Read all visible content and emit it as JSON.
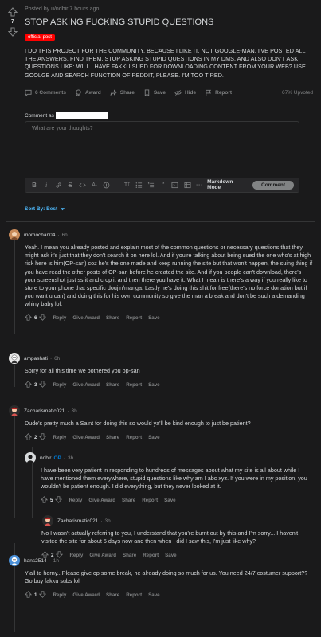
{
  "post": {
    "score": "7",
    "meta": "Posted by u/ndbir 7 hours ago",
    "title": "STOP ASKING FUCKING STUPID QUESTIONS",
    "flair": "official post",
    "body": "I DO THIS PROJECT FOR THE COMMUNITY, BECAUSE I LIKE IT, NOT GOOGLE-MAN. I'VE POSTED ALL THE ANSWERS, FIND THEM, STOP ASKING STUPID QUESTIONS IN MY DMS. AND ALSO DON'T ASK QUESTIONS LIKE: WILL I HAVE FAKKU SUED FOR DOWNLOADING CONTENT FROM YOUR WEB? USE GOOLGE AND SEARCH FUNCTION OF REDDIT, PLEASE. I'M TOO TIRED.",
    "actions": {
      "comments": "6 Comments",
      "award": "Award",
      "share": "Share",
      "save": "Save",
      "hide": "Hide",
      "report": "Report",
      "upvoted": "67% Upvoted"
    }
  },
  "composer": {
    "comment_as": "Comment as",
    "placeholder": "What are your thoughts?",
    "markdown_mode": "Markdown Mode",
    "submit": "Comment"
  },
  "sort": {
    "label": "Sort By: Best"
  },
  "comments": [
    {
      "user": "momochan04",
      "time": "6h",
      "avatar_color": "#c98b5a",
      "body": "Yeah. I mean you already posted and explain most of the common questions or necessary questions that they might ask it's just that they don't search it on here lol. And if you're talking about being sued the one who's at high risk here is him(OP-san) coz he's the one made and keep running the site but that won't happen, the suing thing if you have read the other posts of OP-san before he created the site. And if you people can't download, there's your screenshot just ss it and crop it and then there you have it. What I mean is there's a way if you really like to store to your phone that specific doujin/manga. Lastly he's doing this shit for free(there's no force donation but if you want u can) and doing this for his own community so give the man a break and don't be such a demanding whiny baby lol.",
      "score": "6",
      "actions": [
        "Reply",
        "Give Award",
        "Share",
        "Report",
        "Save"
      ]
    },
    {
      "user": "ampashati",
      "time": "6h",
      "avatar_color": "#e8e8e8",
      "body": "Sorry for all this time we bothered you op-san",
      "score": "3",
      "actions": [
        "Reply",
        "Give Award",
        "Share",
        "Report",
        "Save"
      ]
    },
    {
      "user": "Zacharismatic021",
      "time": "3h",
      "avatar_color": "#d9534f",
      "body": "Dude's pretty much a Saint for doing this so would ya'll be kind enough to just be patient?",
      "score": "2",
      "actions": [
        "Reply",
        "Give Award",
        "Share",
        "Report",
        "Save"
      ]
    },
    {
      "user": "ndbir",
      "op": "OP",
      "time": "3h",
      "avatar_color": "#d7dadc",
      "body": "I have been very patient in responding to hundreds of messages about what my site is all about while I have mentioned them everywhere, stupid questions like why am I abc xyz. If you were in my position, you wouldn't be patient enough. I did everything, but they never looked at it.",
      "score": "5",
      "actions": [
        "Reply",
        "Give Award",
        "Share",
        "Report",
        "Save"
      ]
    },
    {
      "user": "Zacharismatic021",
      "time": "3h",
      "avatar_color": "#d9534f",
      "body": "No I wasn't actually referring to you, I understand that you're burnt out by this and I'm sorry... I haven't visited the site for about 5 days now and then when I did I saw this, I'm just like why?",
      "score": "2",
      "actions": [
        "Reply",
        "Give Award",
        "Share",
        "Report",
        "Save"
      ]
    },
    {
      "user": "hans2514",
      "time": "1h",
      "avatar_color": "#4a90d9",
      "body": "Y'all to horny.. Please give op some break, he already doing so much for us. You need 24/7 costumer support?? Go buy fakku subs lol",
      "score": "1",
      "actions": [
        "Reply",
        "Give Award",
        "Share",
        "Report",
        "Save"
      ]
    }
  ]
}
